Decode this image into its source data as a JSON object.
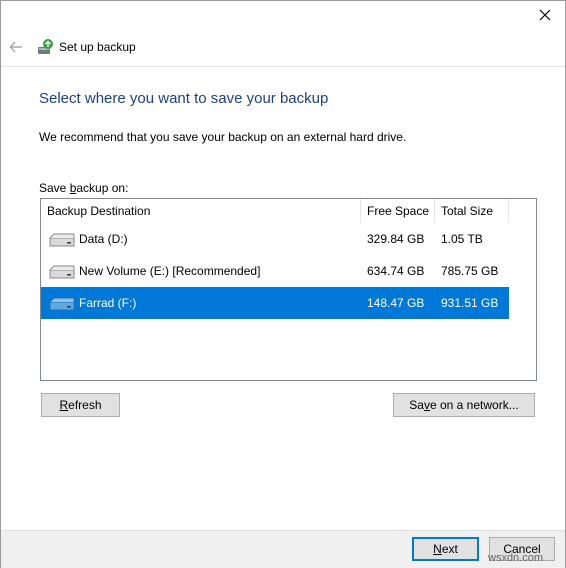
{
  "window": {
    "title": "Set up backup"
  },
  "page": {
    "heading": "Select where you want to save your backup",
    "recommendation": "We recommend that you save your backup on an external hard drive.",
    "save_label_pre": "Save ",
    "save_label_accel": "b",
    "save_label_post": "ackup on:"
  },
  "table": {
    "columns": [
      "Backup Destination",
      "Free Space",
      "Total Size"
    ],
    "rows": [
      {
        "name": "Data (D:)",
        "free": "329.84 GB",
        "total": "1.05 TB",
        "selected": false
      },
      {
        "name": "New Volume (E:) [Recommended]",
        "free": "634.74 GB",
        "total": "785.75 GB",
        "selected": false
      },
      {
        "name": "Farrad (F:)",
        "free": "148.47 GB",
        "total": "931.51 GB",
        "selected": true
      }
    ]
  },
  "buttons": {
    "refresh_accel": "R",
    "refresh_rest": "efresh",
    "network_pre": "Sa",
    "network_accel": "v",
    "network_post": "e on a network...",
    "next_accel": "N",
    "next_rest": "ext",
    "cancel": "Cancel"
  },
  "watermark": "wsxdn.com",
  "icons": {
    "close": "close-icon",
    "back": "back-arrow-icon",
    "app": "backup-icon",
    "drive": "hard-drive-icon"
  },
  "colors": {
    "heading": "#1e3f8c",
    "selection": "#0078d7"
  }
}
